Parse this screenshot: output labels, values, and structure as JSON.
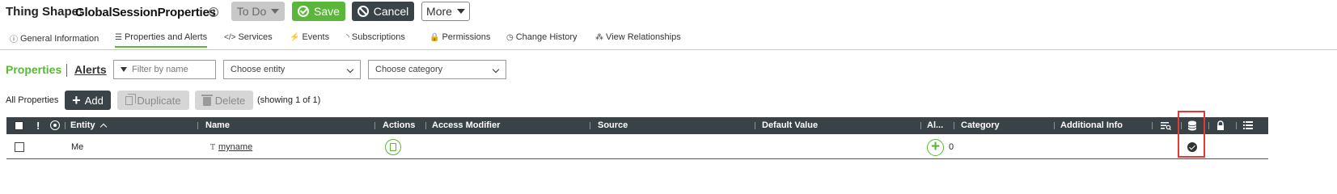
{
  "header": {
    "title_prefix": "Thing Shape:",
    "title_name": "GlobalSessionProperties",
    "help_glyph": "?",
    "todo_label": "To Do",
    "save_label": "Save",
    "cancel_label": "Cancel",
    "more_label": "More"
  },
  "tabs": [
    {
      "label": "General Information",
      "icon": "info-icon",
      "glyph": "ⓘ"
    },
    {
      "label": "Properties and Alerts",
      "icon": "list-icon",
      "glyph": "☰",
      "active": true
    },
    {
      "label": "Services",
      "icon": "code-icon",
      "glyph": "</>"
    },
    {
      "label": "Events",
      "icon": "lightning-icon",
      "glyph": "⚡"
    },
    {
      "label": "Subscriptions",
      "icon": "rss-icon",
      "glyph": "◝"
    },
    {
      "label": "Permissions",
      "icon": "lock-icon",
      "glyph": "🔒"
    },
    {
      "label": "Change History",
      "icon": "clock-icon",
      "glyph": "◷"
    },
    {
      "label": "View Relationships",
      "icon": "sitemap-icon",
      "glyph": "⁂"
    }
  ],
  "toolbar": {
    "properties_link": "Properties",
    "alerts_link": "Alerts",
    "filter_placeholder": "Filter by name",
    "entity_select": "Choose entity",
    "category_select": "Choose category",
    "all_properties_label": "All Properties",
    "add_label": "Add",
    "duplicate_label": "Duplicate",
    "delete_label": "Delete",
    "showing_text": "(showing 1 of 1)"
  },
  "grid": {
    "headers": {
      "alert_glyph": "!",
      "entity": "Entity",
      "name": "Name",
      "actions": "Actions",
      "access_modifier": "Access Modifier",
      "source": "Source",
      "default_value": "Default Value",
      "alerts_short": "Al...",
      "category": "Category",
      "additional_info": "Additional Info"
    },
    "rows": [
      {
        "entity": "Me",
        "type_glyph": "T",
        "name": "myname",
        "alert_count": "0",
        "persistent": true
      }
    ]
  },
  "colors": {
    "accent_green": "#5bb739",
    "header_dark": "#394347",
    "highlight_red": "#e53935"
  }
}
